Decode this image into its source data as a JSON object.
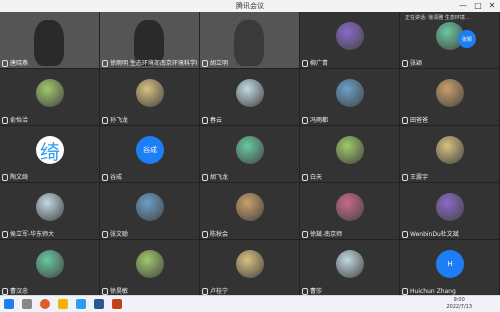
{
  "window": {
    "title": "腾讯会议",
    "minimize": "—",
    "maximize": "□",
    "close": "✕"
  },
  "top_strip": "正在讲话: 徐清雅  生态环境…",
  "host_avatar": "张颖",
  "participants": [
    {
      "name": "唐晓燕",
      "kind": "video"
    },
    {
      "name": "徐雨明 生态环境部南京环境科学研…",
      "kind": "video"
    },
    {
      "name": "胡立明",
      "kind": "video"
    },
    {
      "name": "柳广青",
      "kind": "photo"
    },
    {
      "name": "张颖",
      "kind": "photo"
    },
    {
      "name": "俞怡洽",
      "kind": "photo"
    },
    {
      "name": "孙飞龙",
      "kind": "photo"
    },
    {
      "name": "春云",
      "kind": "photo"
    },
    {
      "name": "冯雨都",
      "kind": "photo"
    },
    {
      "name": "田爸爸",
      "kind": "photo"
    },
    {
      "name": "陶文绮",
      "kind": "glyph",
      "glyph": "绮"
    },
    {
      "name": "谷成",
      "kind": "letter",
      "letter": "谷成"
    },
    {
      "name": "胡飞龙",
      "kind": "photo"
    },
    {
      "name": "白天",
      "kind": "photo"
    },
    {
      "name": "王震宇",
      "kind": "photo"
    },
    {
      "name": "侯立军-华东师大",
      "kind": "photo"
    },
    {
      "name": "张文聪",
      "kind": "photo"
    },
    {
      "name": "陈秋会",
      "kind": "photo"
    },
    {
      "name": "徐斌-南京师",
      "kind": "photo"
    },
    {
      "name": "WenbinDu杜文斌",
      "kind": "photo"
    },
    {
      "name": "曹汉忠",
      "kind": "photo"
    },
    {
      "name": "徐昊敏",
      "kind": "photo"
    },
    {
      "name": "卢桂宁",
      "kind": "photo"
    },
    {
      "name": "曹莎",
      "kind": "photo"
    },
    {
      "name": "Huichun Zhang",
      "kind": "letter",
      "letter": "H"
    }
  ],
  "taskbar": {
    "time": "9:00",
    "date": "2022/7/13"
  },
  "colors": {
    "accent": "#1e7ef5",
    "tile_bg": "#333333",
    "grid_bg": "#222222"
  }
}
